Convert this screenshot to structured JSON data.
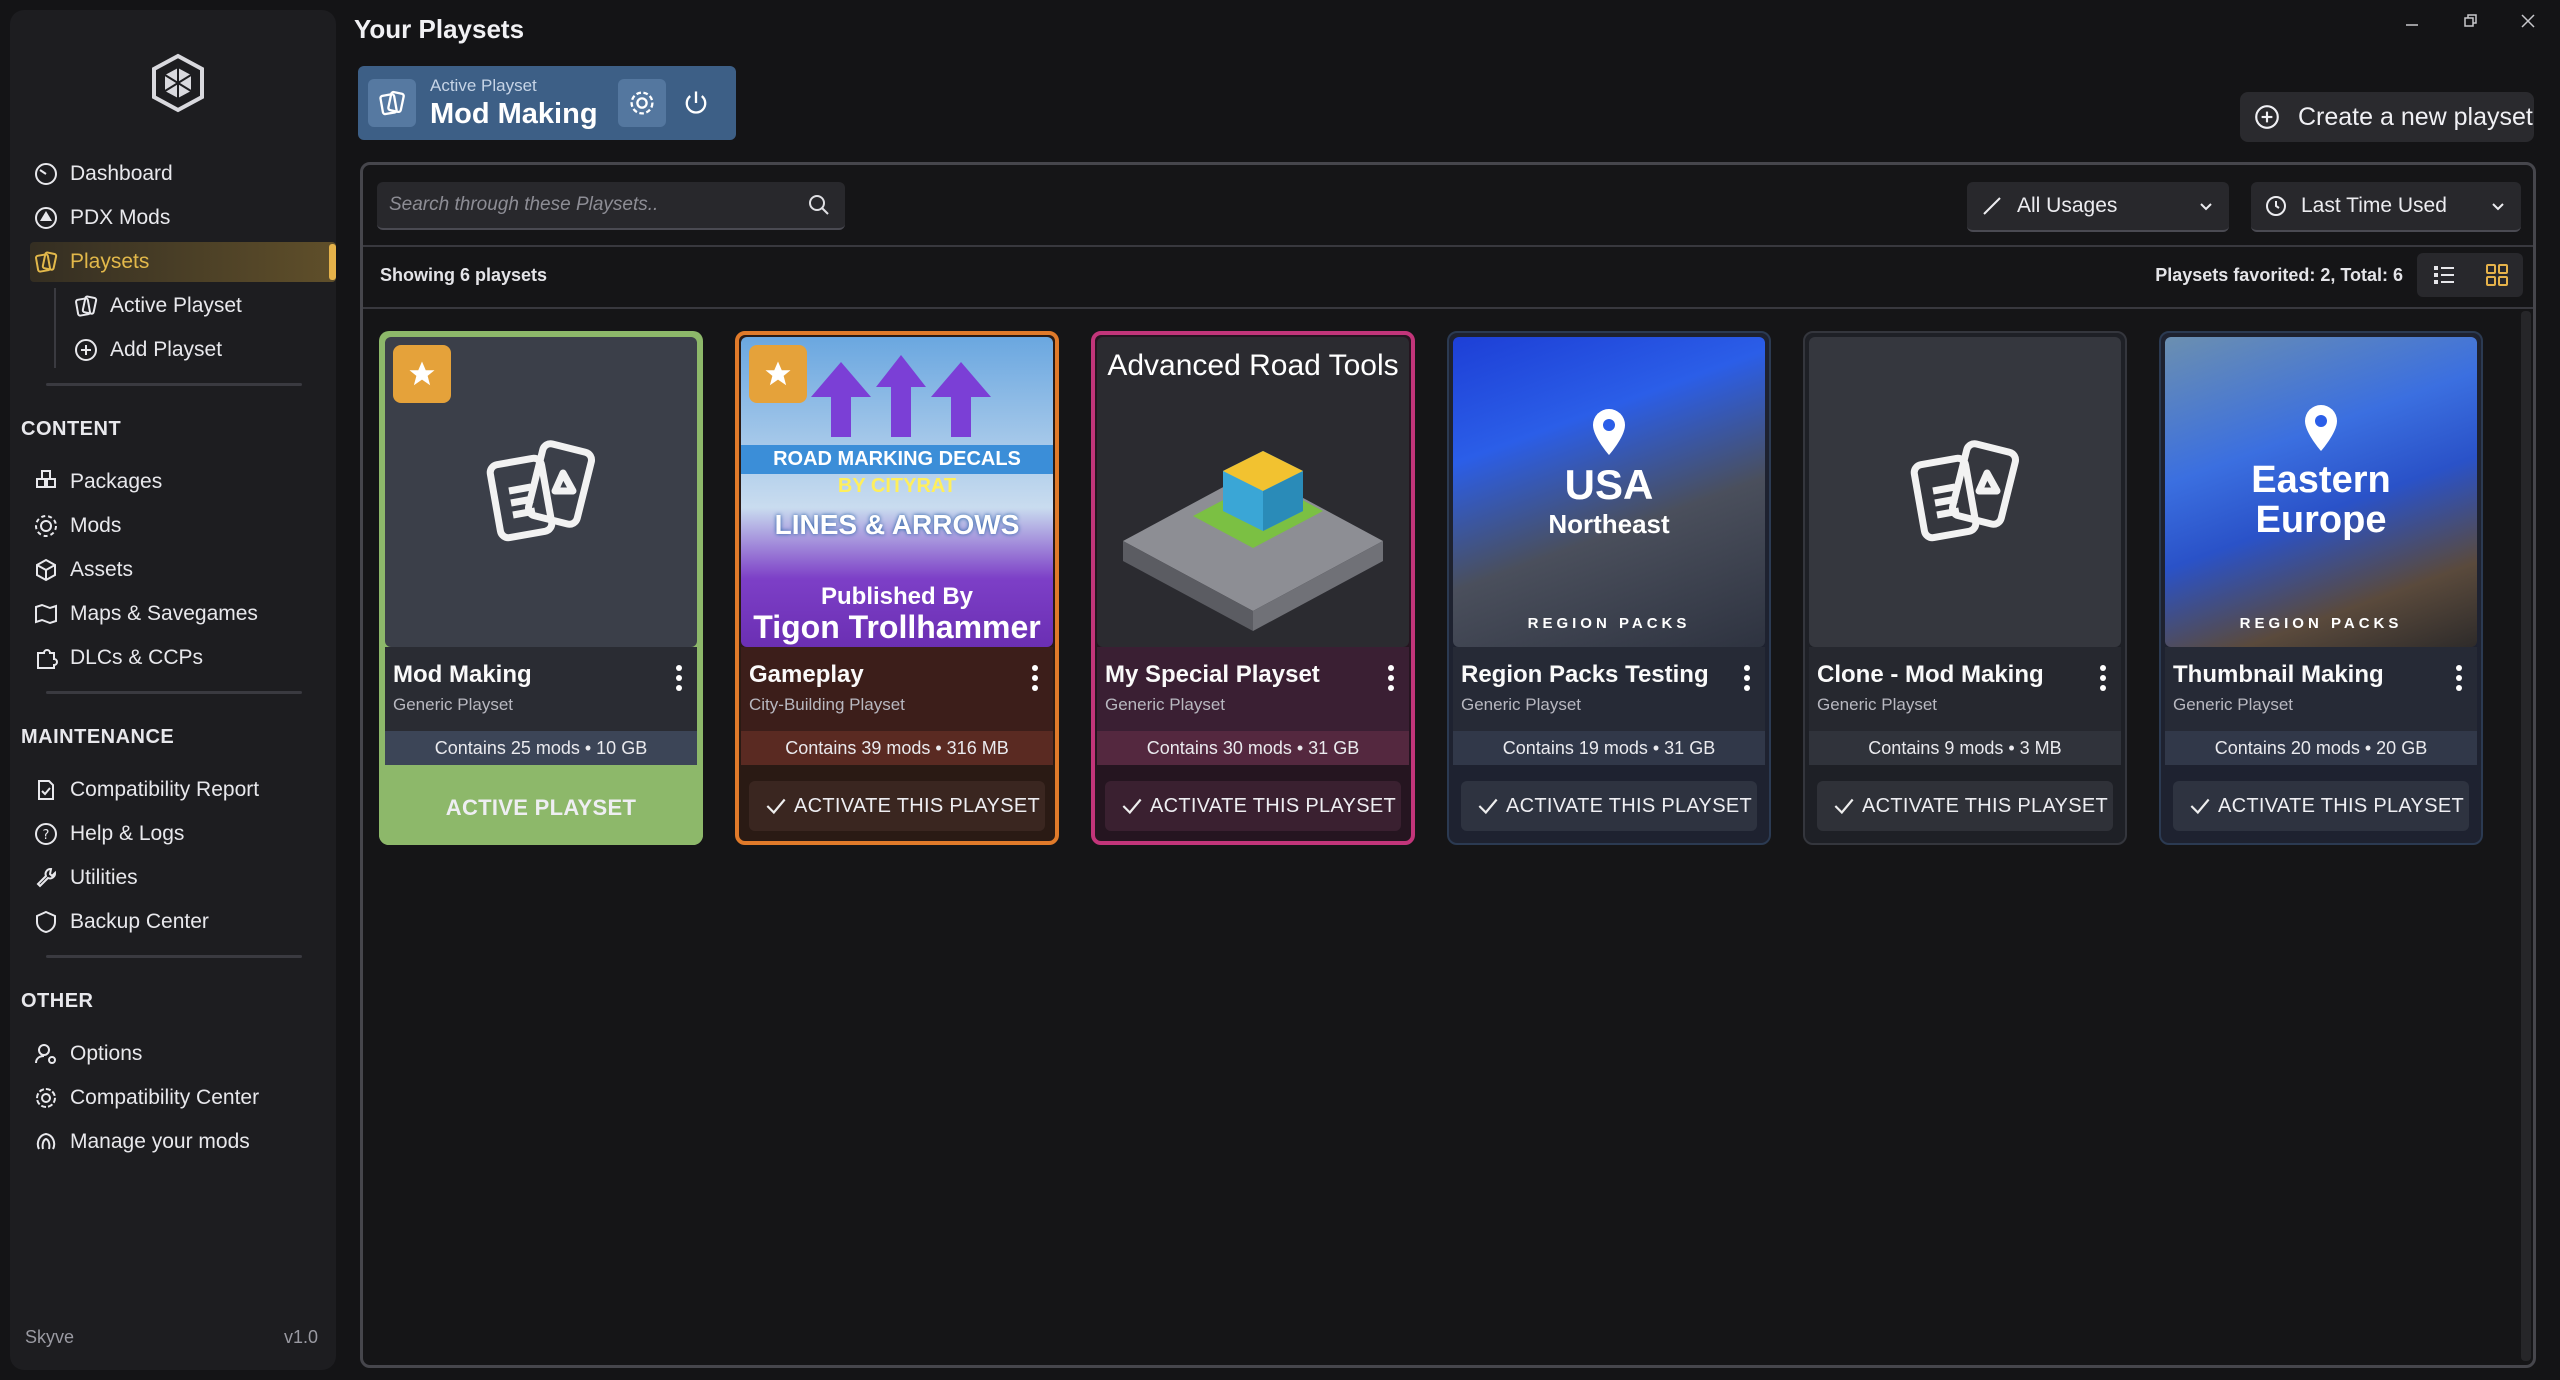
{
  "header": {
    "title": "Your Playsets",
    "window_controls": [
      "minimize-icon",
      "restore-icon",
      "close-icon"
    ]
  },
  "active_playset": {
    "label": "Active Playset",
    "name": "Mod Making"
  },
  "create_button": {
    "label": "Create a new playset"
  },
  "sidebar": {
    "nav": [
      {
        "label": "Dashboard",
        "icon": "dashboard-icon"
      },
      {
        "label": "PDX Mods",
        "icon": "pdx-mods-icon"
      },
      {
        "label": "Playsets",
        "icon": "playsets-icon",
        "active": true
      },
      {
        "label": "Active Playset",
        "icon": "active-playset-icon"
      },
      {
        "label": "Add Playset",
        "icon": "add-icon"
      }
    ],
    "content_title": "CONTENT",
    "content": [
      {
        "label": "Packages",
        "icon": "packages-icon"
      },
      {
        "label": "Mods",
        "icon": "mods-icon"
      },
      {
        "label": "Assets",
        "icon": "assets-icon"
      },
      {
        "label": "Maps & Savegames",
        "icon": "maps-icon"
      },
      {
        "label": "DLCs & CCPs",
        "icon": "dlcs-icon"
      }
    ],
    "maintenance_title": "MAINTENANCE",
    "maintenance": [
      {
        "label": "Compatibility Report",
        "icon": "compatibility-report-icon"
      },
      {
        "label": "Help & Logs",
        "icon": "help-icon"
      },
      {
        "label": "Utilities",
        "icon": "utilities-icon"
      },
      {
        "label": "Backup Center",
        "icon": "backup-icon"
      }
    ],
    "other_title": "OTHER",
    "other": [
      {
        "label": "Options",
        "icon": "options-icon"
      },
      {
        "label": "Compatibility Center",
        "icon": "compatibility-center-icon"
      },
      {
        "label": "Manage your mods",
        "icon": "manage-mods-icon"
      }
    ],
    "footer_app": "Skyve",
    "footer_version": "v1.0",
    "accent": "#e5b24a"
  },
  "toolbar": {
    "search_placeholder": "Search through these Playsets..",
    "usage_filter": "All Usages",
    "sort": "Last Time Used",
    "showing": "Showing 6 playsets",
    "fav_total": "Playsets favorited: 2, Total: 6"
  },
  "cards": [
    {
      "title": "Mod Making",
      "subtitle": "Generic Playset",
      "stats": "Contains 25 mods • 10 GB",
      "action": "ACTIVE PLAYSET",
      "favorite": true,
      "color": "#8db86a"
    },
    {
      "title": "Gameplay",
      "subtitle": "City-Building Playset",
      "stats": "Contains 39 mods • 316 MB",
      "action": "ACTIVATE THIS PLAYSET",
      "favorite": true,
      "color": "#e07a2a",
      "thumb_text": [
        "ROAD MARKING DECALS",
        "BY CITYRAT",
        "LINES & ARROWS",
        "Published By",
        "Tigon Trollhammer"
      ]
    },
    {
      "title": "My Special Playset",
      "subtitle": "Generic Playset",
      "stats": "Contains 30 mods • 31 GB",
      "action": "ACTIVATE THIS PLAYSET",
      "favorite": false,
      "color": "#c2357a",
      "thumb_text": [
        "Advanced Road Tools"
      ]
    },
    {
      "title": "Region Packs Testing",
      "subtitle": "Generic Playset",
      "stats": "Contains 19 mods • 31 GB",
      "action": "ACTIVATE THIS PLAYSET",
      "favorite": false,
      "color": "#2b3a52",
      "thumb_text": [
        "USA",
        "Northeast",
        "REGION PACKS"
      ]
    },
    {
      "title": "Clone - Mod Making",
      "subtitle": "Generic Playset",
      "stats": "Contains 9 mods • 3 MB",
      "action": "ACTIVATE THIS PLAYSET",
      "favorite": false,
      "color": "#34363d"
    },
    {
      "title": "Thumbnail Making",
      "subtitle": "Generic Playset",
      "stats": "Contains 20 mods • 20 GB",
      "action": "ACTIVATE THIS PLAYSET",
      "favorite": false,
      "color": "#2b3a52",
      "thumb_text": [
        "Eastern",
        "Europe",
        "REGION PACKS"
      ]
    }
  ]
}
